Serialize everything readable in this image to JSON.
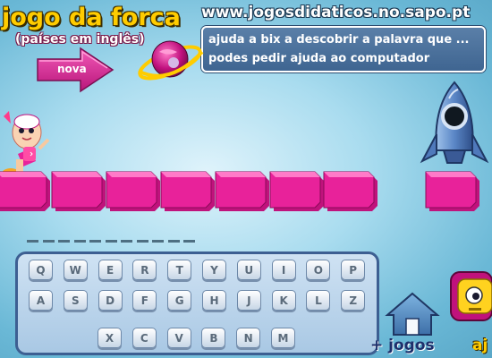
{
  "title": "jogo da forca",
  "subtitle": "(países em inglês)",
  "site_url": "www.jogosdidaticos.no.sapo.pt",
  "instructions": [
    "ajuda a bix a descobrir a palavra que ...",
    "podes pedir ajuda ao computador"
  ],
  "nova_button": {
    "label": "nova",
    "icon": "arrow-right-icon"
  },
  "word_slot_count": 11,
  "keyboard": {
    "rows": [
      [
        "Q",
        "W",
        "E",
        "R",
        "T",
        "Y",
        "U",
        "I",
        "O",
        "P"
      ],
      [
        "A",
        "S",
        "D",
        "F",
        "G",
        "H",
        "J",
        "K",
        "L",
        "Z"
      ],
      [
        "X",
        "C",
        "V",
        "B",
        "N",
        "M"
      ]
    ]
  },
  "more_games_label": "+ jogos",
  "help_label": "aj",
  "colors": {
    "title": "#ffcc00",
    "block_pink": "#e8229a",
    "instruction_box": "#4a70a0",
    "keyboard_border": "#3d5f92"
  }
}
